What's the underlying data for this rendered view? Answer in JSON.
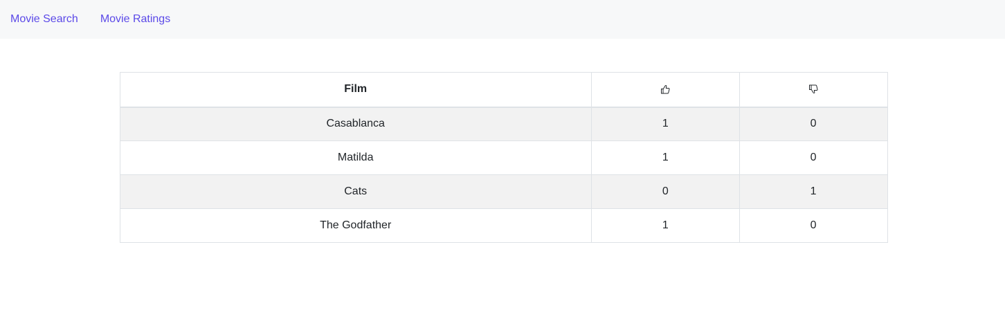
{
  "nav": {
    "items": [
      {
        "label": "Movie Search"
      },
      {
        "label": "Movie Ratings"
      }
    ]
  },
  "table": {
    "headers": {
      "film": "Film",
      "thumbs_up_icon": "thumbs-up-icon",
      "thumbs_down_icon": "thumbs-down-icon"
    },
    "rows": [
      {
        "film": "Casablanca",
        "up": "1",
        "down": "0"
      },
      {
        "film": "Matilda",
        "up": "1",
        "down": "0"
      },
      {
        "film": "Cats",
        "up": "0",
        "down": "1"
      },
      {
        "film": "The Godfather",
        "up": "1",
        "down": "0"
      }
    ]
  },
  "colors": {
    "link": "#5b49e8",
    "navbar_bg": "#f7f8f9",
    "stripe": "#f2f2f2",
    "border": "#dee2e6"
  }
}
